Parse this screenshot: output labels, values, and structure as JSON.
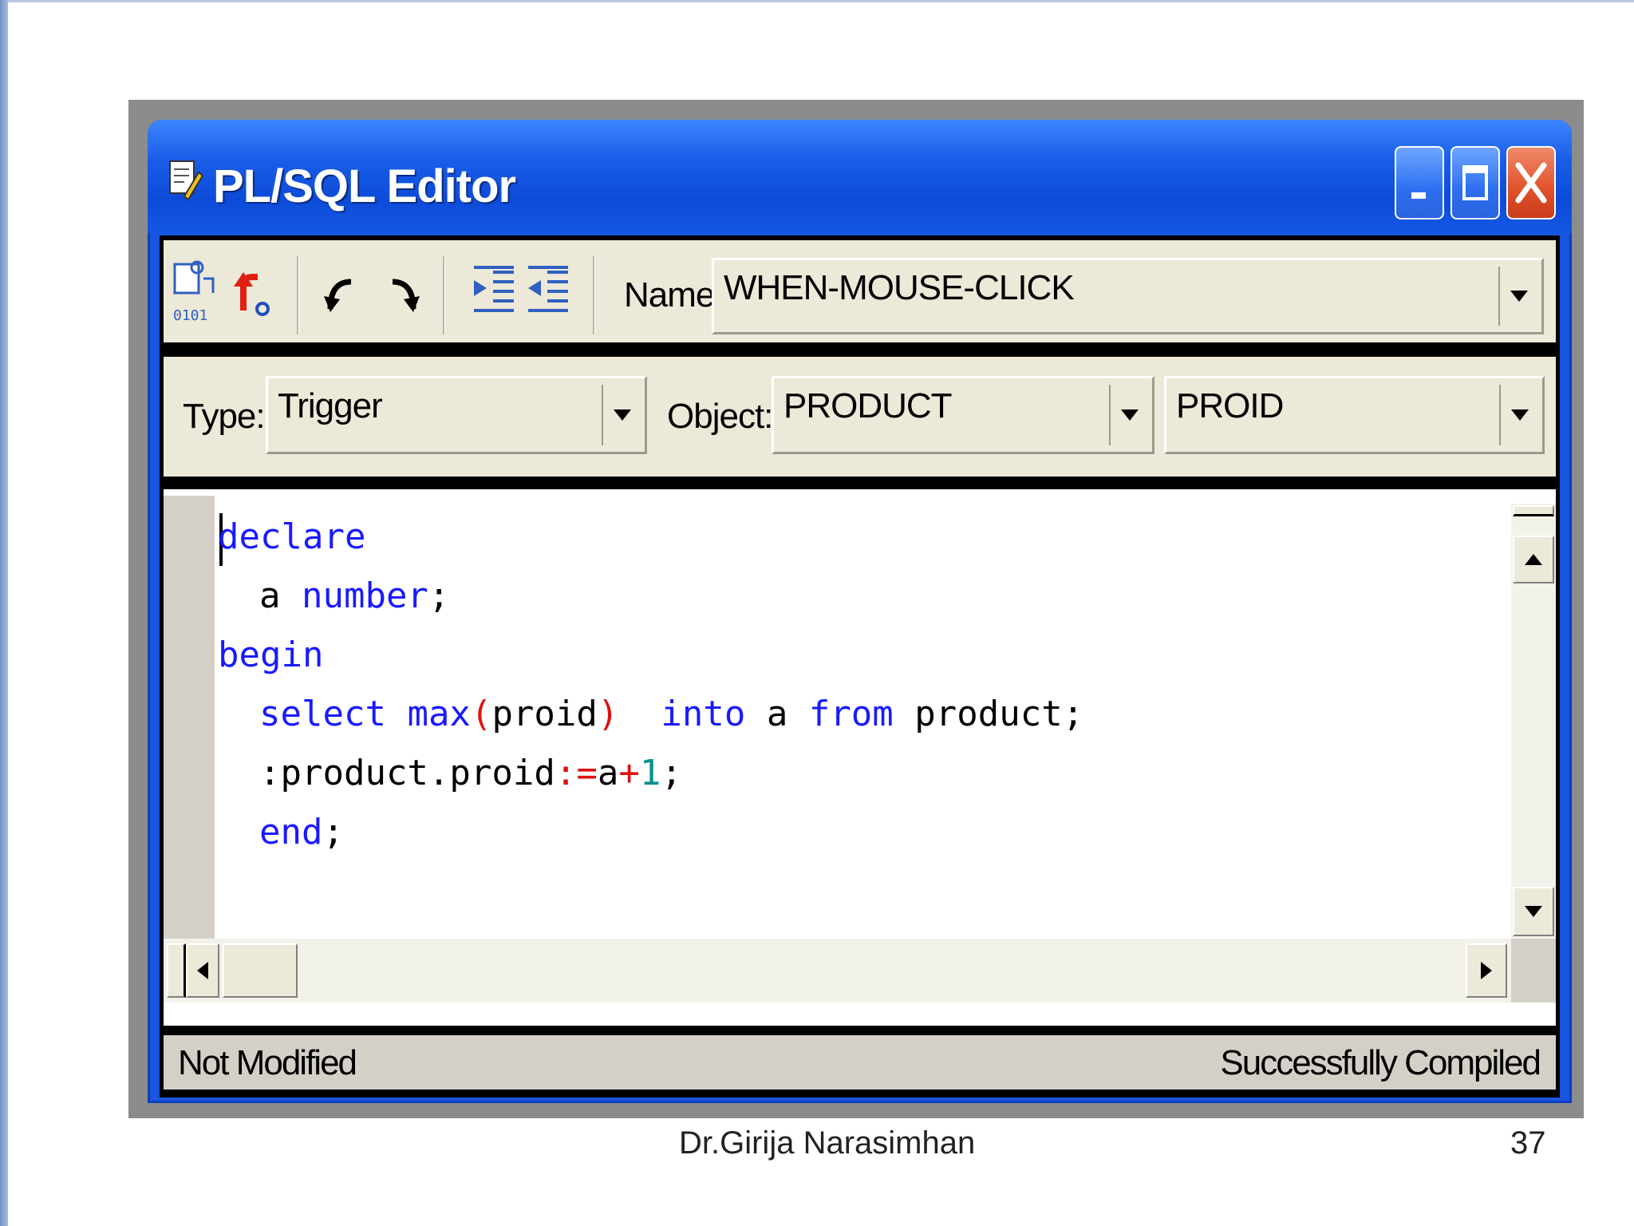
{
  "window": {
    "title": "PL/SQL Editor",
    "controls": [
      "minimize",
      "maximize",
      "close"
    ]
  },
  "toolbar": {
    "icons": [
      "compile-icon",
      "run-icon",
      "undo-icon",
      "redo-icon",
      "indent-icon",
      "unindent-icon"
    ],
    "name_label": "Name:",
    "name_value": "WHEN-MOUSE-CLICK"
  },
  "selectors": {
    "type_label": "Type:",
    "type_value": "Trigger",
    "object_label": "Object:",
    "object_value": "PRODUCT",
    "item_value": "PROID"
  },
  "code": {
    "line1": "declare",
    "line2_a": "a ",
    "line2_b": "number",
    "line2_c": ";",
    "line3": "begin",
    "line4_select": "select",
    "line4_max": "max",
    "line4_open": "(",
    "line4_arg": "proid",
    "line4_close": ")",
    "line4_into": "into",
    "line4_a": " a ",
    "line4_from": "from",
    "line4_table": " product;",
    "line5_ref": ":product.proid",
    "line5_assign": ":=",
    "line5_a": "a",
    "line5_plus": "+",
    "line5_one": "1",
    "line5_end": ";",
    "line6_end": "end",
    "line6_semi": ";"
  },
  "status": {
    "left": "Not Modified",
    "right": "Successfully Compiled"
  },
  "footer": {
    "author": "Dr.Girija Narasimhan",
    "page_number": "37"
  }
}
